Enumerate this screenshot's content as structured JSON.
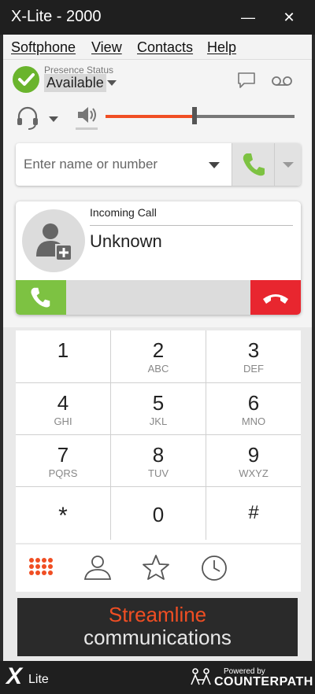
{
  "window": {
    "title": "X-Lite - 2000",
    "minimize": "—",
    "close": "✕"
  },
  "menu": [
    "Softphone",
    "View",
    "Contacts",
    "Help"
  ],
  "presence": {
    "label": "Presence Status",
    "value": "Available",
    "color": "#6ab42d"
  },
  "volume": {
    "level": 0.47,
    "accent": "#f04e23"
  },
  "dial": {
    "placeholder": "Enter name or number",
    "call_color": "#7dc242"
  },
  "incoming_call": {
    "title": "Incoming Call",
    "caller": "Unknown",
    "answer_color": "#7dc242",
    "decline_color": "#e8262f"
  },
  "keypad": [
    {
      "num": "1",
      "sub": ""
    },
    {
      "num": "2",
      "sub": "ABC"
    },
    {
      "num": "3",
      "sub": "DEF"
    },
    {
      "num": "4",
      "sub": "GHI"
    },
    {
      "num": "5",
      "sub": "JKL"
    },
    {
      "num": "6",
      "sub": "MNO"
    },
    {
      "num": "7",
      "sub": "PQRS"
    },
    {
      "num": "8",
      "sub": "TUV"
    },
    {
      "num": "9",
      "sub": "WXYZ"
    },
    {
      "num": "*",
      "sub": ""
    },
    {
      "num": "0",
      "sub": ""
    },
    {
      "num": "#",
      "sub": ""
    }
  ],
  "tabs": [
    "dialpad-icon",
    "contacts-icon",
    "favorites-icon",
    "history-icon"
  ],
  "banner": {
    "line1": "Streamline",
    "line2": "communications"
  },
  "footer": {
    "logo_x": "X",
    "logo_lite": "Lite",
    "powered_by": "Powered by",
    "brand": "COUNTERPATH"
  }
}
